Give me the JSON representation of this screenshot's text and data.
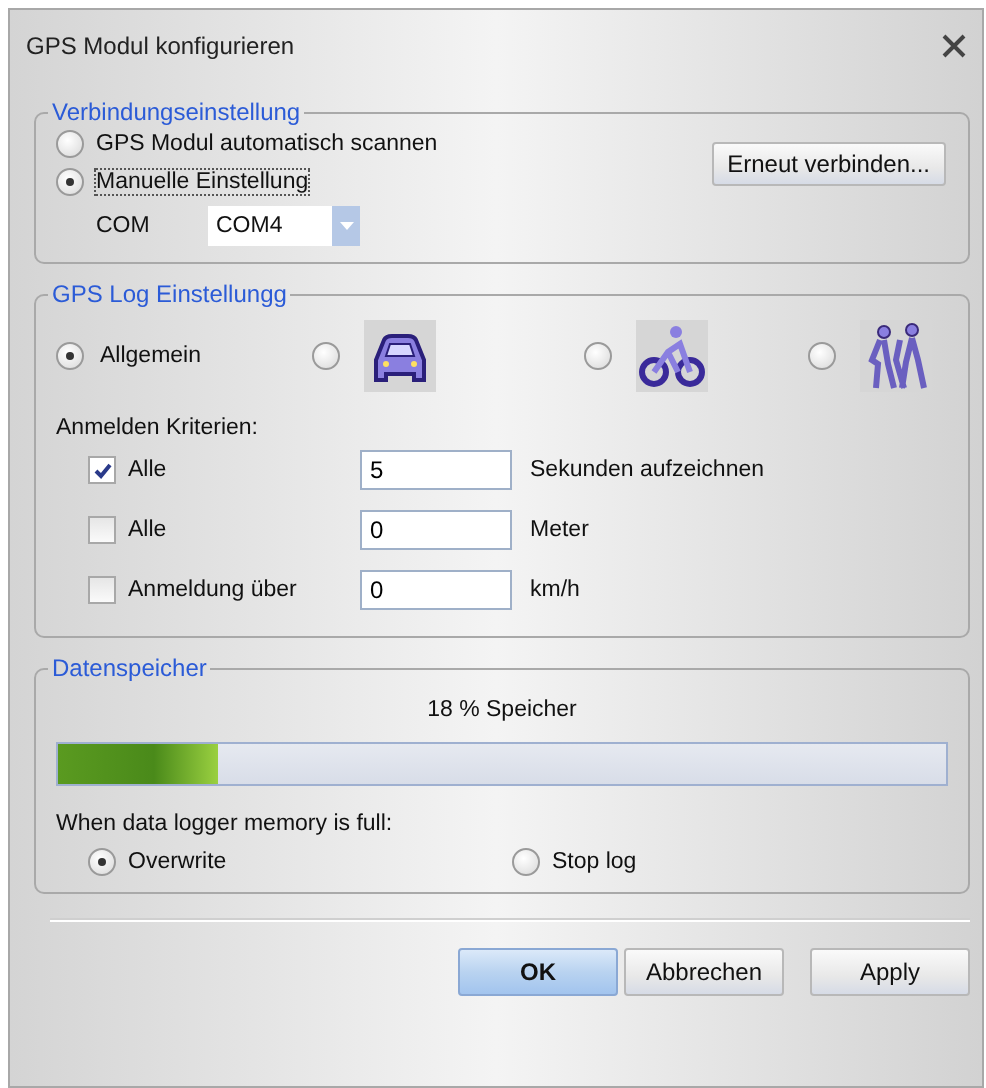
{
  "window": {
    "title": "GPS Modul konfigurieren"
  },
  "connection": {
    "title": "Verbindungseinstellung",
    "options": [
      {
        "label": "GPS Modul automatisch scannen",
        "selected": false
      },
      {
        "label": "Manuelle Einstellung",
        "selected": true
      }
    ],
    "reconnect_button": "Erneut verbinden...",
    "port_label": "COM",
    "port_value": "COM4"
  },
  "log": {
    "title": "GPS Log Einstellungg",
    "modes": [
      {
        "kind": "text",
        "label": "Allgemein",
        "selected": true
      },
      {
        "kind": "car",
        "selected": false
      },
      {
        "kind": "bike",
        "selected": false
      },
      {
        "kind": "hike",
        "selected": false
      }
    ],
    "criteria_label": "Anmelden Kriterien:",
    "criteria": [
      {
        "label": "Alle",
        "checked": true,
        "value": "5",
        "unit": "Sekunden aufzeichnen"
      },
      {
        "label": "Alle",
        "checked": false,
        "value": "0",
        "unit": "Meter"
      },
      {
        "label": "Anmeldung über",
        "checked": false,
        "value": "0",
        "unit": "km/h"
      }
    ]
  },
  "memory": {
    "title": "Datenspeicher",
    "reading": "18 % Speicher",
    "level": 0.18,
    "full_label": "When data logger memory is full:",
    "options": [
      {
        "label": "Overwrite",
        "selected": true
      },
      {
        "label": "Stop log",
        "selected": false
      }
    ]
  },
  "buttons": [
    {
      "label": "OK",
      "kind": "default"
    },
    {
      "label": "Abbrechen",
      "kind": "normal"
    },
    {
      "label": "Apply",
      "kind": "normal"
    }
  ]
}
